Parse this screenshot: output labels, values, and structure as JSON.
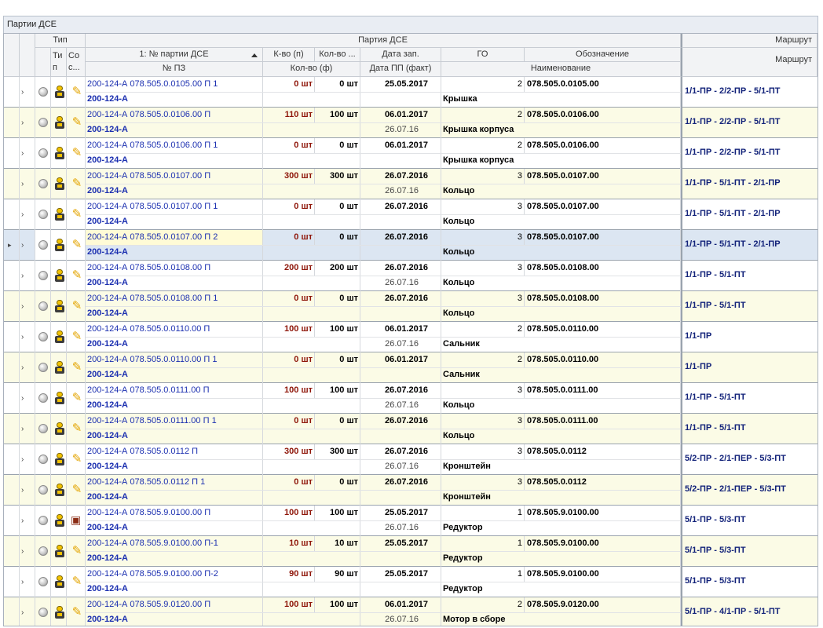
{
  "panel": {
    "title": "Партии ДСЕ"
  },
  "header": {
    "tip_group": "Тип",
    "partiya_group": "Партия ДСЕ",
    "marshrut_group": "Маршрут",
    "tip": "Ти п",
    "sostoyanie": "Со с...",
    "nomer_partii": "1: № партии ДСЕ",
    "kvo_p": "К-во (п)",
    "kolvo_dots": "Кол-во ...",
    "data_zap": "Дата зап.",
    "go": "ГО",
    "oboznachenie": "Обозначение",
    "nomer_pz": "№ ПЗ",
    "kolvo_f": "Кол-во (ф)",
    "data_pp": "Дата ПП (факт)",
    "naimenovanie": "Наименование",
    "marshrut": "Маршрут"
  },
  "rows": [
    {
      "partiya": "200-124-А 078.505.0.0105.00 П 1",
      "pz": "200-124-А",
      "kvo_p": "0 шт",
      "kvo_f": "0 шт",
      "data_zap": "25.05.2017",
      "data_pp": "",
      "go": "2",
      "oboznachenie": "078.505.0.0105.00",
      "naimenovanie": "Крышка",
      "marshrut": "1/1-ПР - 2/2-ПР - 5/1-ПТ",
      "status_icon": "pencil-icon"
    },
    {
      "partiya": "200-124-А 078.505.0.0106.00 П",
      "pz": "200-124-А",
      "kvo_p": "110 шт",
      "kvo_f": "100 шт",
      "data_zap": "06.01.2017",
      "data_pp": "26.07.16",
      "go": "2",
      "oboznachenie": "078.505.0.0106.00",
      "naimenovanie": "Крышка корпуса",
      "marshrut": "1/1-ПР - 2/2-ПР - 5/1-ПТ",
      "status_icon": "pencil-icon"
    },
    {
      "partiya": "200-124-А 078.505.0.0106.00 П 1",
      "pz": "200-124-А",
      "kvo_p": "0 шт",
      "kvo_f": "0 шт",
      "data_zap": "06.01.2017",
      "data_pp": "",
      "go": "2",
      "oboznachenie": "078.505.0.0106.00",
      "naimenovanie": "Крышка корпуса",
      "marshrut": "1/1-ПР - 2/2-ПР - 5/1-ПТ",
      "status_icon": "pencil-icon"
    },
    {
      "partiya": "200-124-А 078.505.0.0107.00 П",
      "pz": "200-124-А",
      "kvo_p": "300 шт",
      "kvo_f": "300 шт",
      "data_zap": "26.07.2016",
      "data_pp": "26.07.16",
      "go": "3",
      "oboznachenie": "078.505.0.0107.00",
      "naimenovanie": "Кольцо",
      "marshrut": "1/1-ПР - 5/1-ПТ - 2/1-ПР",
      "status_icon": "pencil-icon"
    },
    {
      "partiya": "200-124-А 078.505.0.0107.00 П 1",
      "pz": "200-124-А",
      "kvo_p": "0 шт",
      "kvo_f": "0 шт",
      "data_zap": "26.07.2016",
      "data_pp": "",
      "go": "3",
      "oboznachenie": "078.505.0.0107.00",
      "naimenovanie": "Кольцо",
      "marshrut": "1/1-ПР - 5/1-ПТ - 2/1-ПР",
      "status_icon": "pencil-icon"
    },
    {
      "partiya": "200-124-А 078.505.0.0107.00 П 2",
      "pz": "200-124-А",
      "kvo_p": "0 шт",
      "kvo_f": "0 шт",
      "data_zap": "26.07.2016",
      "data_pp": "",
      "go": "3",
      "oboznachenie": "078.505.0.0107.00",
      "naimenovanie": "Кольцо",
      "marshrut": "1/1-ПР - 5/1-ПТ - 2/1-ПР",
      "status_icon": "pencil-icon",
      "selected": true
    },
    {
      "partiya": "200-124-А 078.505.0.0108.00 П",
      "pz": "200-124-А",
      "kvo_p": "200 шт",
      "kvo_f": "200 шт",
      "data_zap": "26.07.2016",
      "data_pp": "26.07.16",
      "go": "3",
      "oboznachenie": "078.505.0.0108.00",
      "naimenovanie": "Кольцо",
      "marshrut": "1/1-ПР - 5/1-ПТ",
      "status_icon": "pencil-icon"
    },
    {
      "partiya": "200-124-А 078.505.0.0108.00 П 1",
      "pz": "200-124-А",
      "kvo_p": "0 шт",
      "kvo_f": "0 шт",
      "data_zap": "26.07.2016",
      "data_pp": "",
      "go": "3",
      "oboznachenie": "078.505.0.0108.00",
      "naimenovanie": "Кольцо",
      "marshrut": "1/1-ПР - 5/1-ПТ",
      "status_icon": "pencil-icon"
    },
    {
      "partiya": "200-124-А 078.505.0.0110.00 П",
      "pz": "200-124-А",
      "kvo_p": "100 шт",
      "kvo_f": "100 шт",
      "data_zap": "06.01.2017",
      "data_pp": "26.07.16",
      "go": "2",
      "oboznachenie": "078.505.0.0110.00",
      "naimenovanie": "Сальник",
      "marshrut": "1/1-ПР",
      "status_icon": "pencil-icon"
    },
    {
      "partiya": "200-124-А 078.505.0.0110.00 П 1",
      "pz": "200-124-А",
      "kvo_p": "0 шт",
      "kvo_f": "0 шт",
      "data_zap": "06.01.2017",
      "data_pp": "",
      "go": "2",
      "oboznachenie": "078.505.0.0110.00",
      "naimenovanie": "Сальник",
      "marshrut": "1/1-ПР",
      "status_icon": "pencil-icon"
    },
    {
      "partiya": "200-124-А 078.505.0.0111.00 П",
      "pz": "200-124-А",
      "kvo_p": "100 шт",
      "kvo_f": "100 шт",
      "data_zap": "26.07.2016",
      "data_pp": "26.07.16",
      "go": "3",
      "oboznachenie": "078.505.0.0111.00",
      "naimenovanie": "Кольцо",
      "marshrut": "1/1-ПР - 5/1-ПТ",
      "status_icon": "pencil-icon"
    },
    {
      "partiya": "200-124-А 078.505.0.0111.00 П 1",
      "pz": "200-124-А",
      "kvo_p": "0 шт",
      "kvo_f": "0 шт",
      "data_zap": "26.07.2016",
      "data_pp": "",
      "go": "3",
      "oboznachenie": "078.505.0.0111.00",
      "naimenovanie": "Кольцо",
      "marshrut": "1/1-ПР - 5/1-ПТ",
      "status_icon": "pencil-icon"
    },
    {
      "partiya": "200-124-А 078.505.0.0112 П",
      "pz": "200-124-А",
      "kvo_p": "300 шт",
      "kvo_f": "300 шт",
      "data_zap": "26.07.2016",
      "data_pp": "26.07.16",
      "go": "3",
      "oboznachenie": "078.505.0.0112",
      "naimenovanie": "Кронштейн",
      "marshrut": "5/2-ПР - 2/1-ПЕР - 5/3-ПТ",
      "status_icon": "pencil-icon"
    },
    {
      "partiya": "200-124-А 078.505.0.0112 П 1",
      "pz": "200-124-А",
      "kvo_p": "0 шт",
      "kvo_f": "0 шт",
      "data_zap": "26.07.2016",
      "data_pp": "",
      "go": "3",
      "oboznachenie": "078.505.0.0112",
      "naimenovanie": "Кронштейн",
      "marshrut": "5/2-ПР - 2/1-ПЕР - 5/3-ПТ",
      "status_icon": "pencil-icon"
    },
    {
      "partiya": "200-124-А 078.505.9.0100.00 П",
      "pz": "200-124-А",
      "kvo_p": "100 шт",
      "kvo_f": "100 шт",
      "data_zap": "25.05.2017",
      "data_pp": "26.07.16",
      "go": "1",
      "oboznachenie": "078.505.9.0100.00",
      "naimenovanie": "Редуктор",
      "marshrut": "5/1-ПР - 5/3-ПТ",
      "status_icon": "box-icon"
    },
    {
      "partiya": "200-124-А 078.505.9.0100.00 П-1",
      "pz": "200-124-А",
      "kvo_p": "10 шт",
      "kvo_f": "10 шт",
      "data_zap": "25.05.2017",
      "data_pp": "",
      "go": "1",
      "oboznachenie": "078.505.9.0100.00",
      "naimenovanie": "Редуктор",
      "marshrut": "5/1-ПР - 5/3-ПТ",
      "status_icon": "pencil-icon"
    },
    {
      "partiya": "200-124-А 078.505.9.0100.00 П-2",
      "pz": "200-124-А",
      "kvo_p": "90 шт",
      "kvo_f": "90 шт",
      "data_zap": "25.05.2017",
      "data_pp": "",
      "go": "1",
      "oboznachenie": "078.505.9.0100.00",
      "naimenovanie": "Редуктор",
      "marshrut": "5/1-ПР - 5/3-ПТ",
      "status_icon": "pencil-icon"
    },
    {
      "partiya": "200-124-А 078.505.9.0120.00 П",
      "pz": "200-124-А",
      "kvo_p": "100 шт",
      "kvo_f": "100 шт",
      "data_zap": "06.01.2017",
      "data_pp": "26.07.16",
      "go": "2",
      "oboznachenie": "078.505.9.0120.00",
      "naimenovanie": "Мотор в сборе",
      "marshrut": "5/1-ПР - 4/1-ПР - 5/1-ПТ",
      "status_icon": "pencil-icon"
    }
  ]
}
